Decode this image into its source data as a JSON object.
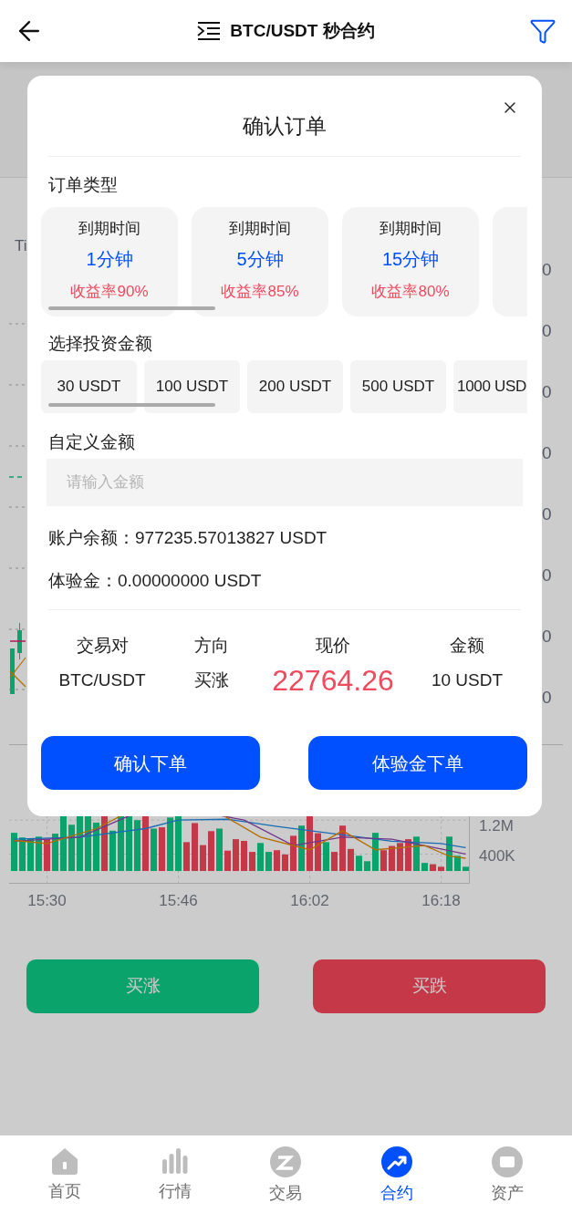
{
  "header": {
    "title": "BTC/USDT 秒合约"
  },
  "background": {
    "left_labels": [
      "Ti"
    ],
    "price_axis": [
      "0",
      "0",
      "0",
      "0",
      "0",
      "0",
      "0",
      "0"
    ],
    "volume_axis": {
      "y_labels": [
        "1.2M",
        "400K"
      ],
      "x_labels": [
        "15:30",
        "15:46",
        "16:02",
        "16:18"
      ]
    }
  },
  "actions": [
    {
      "label": "买涨",
      "kind": "buy"
    },
    {
      "label": "买跌",
      "kind": "sell"
    }
  ],
  "modal": {
    "title": "确认订单",
    "order_type_label": "订单类型",
    "order_types": [
      {
        "kind": "full",
        "caption": "到期时间",
        "duration": "1分钟",
        "yield": "收益率90%"
      },
      {
        "kind": "full",
        "caption": "到期时间",
        "duration": "5分钟",
        "yield": "收益率85%"
      },
      {
        "kind": "full",
        "caption": "到期时间",
        "duration": "15分钟",
        "yield": "收益率80%"
      },
      {
        "kind": "cut"
      }
    ],
    "amount_label": "选择投资金额",
    "amounts": [
      {
        "label": "30 USDT",
        "kind": "full"
      },
      {
        "label": "100 USDT",
        "kind": "full"
      },
      {
        "label": "200 USDT",
        "kind": "full"
      },
      {
        "label": "500 USDT",
        "kind": "full"
      },
      {
        "label": "1000 USD",
        "kind": "cut"
      }
    ],
    "custom_label": "自定义金额",
    "custom_input": {
      "placeholder": "请输入金额"
    },
    "balance": "账户余额：977235.57013827 USDT",
    "trial_funds": "体验金：0.00000000 USDT",
    "summary": [
      {
        "label": "交易对",
        "value": "BTC/USDT",
        "kind": "plain"
      },
      {
        "label": "方向",
        "value": "买涨",
        "kind": "plain"
      },
      {
        "label": "现价",
        "value": "22764.26",
        "kind": "price"
      },
      {
        "label": "金额",
        "value": "10 USDT",
        "kind": "plain"
      }
    ],
    "buttons": [
      "确认下单",
      "体验金下单"
    ]
  },
  "nav": [
    {
      "label": "首页",
      "selected": false
    },
    {
      "label": "行情",
      "selected": false
    },
    {
      "label": "交易",
      "selected": false
    },
    {
      "label": "合约",
      "selected": true
    },
    {
      "label": "资产",
      "selected": false
    }
  ]
}
